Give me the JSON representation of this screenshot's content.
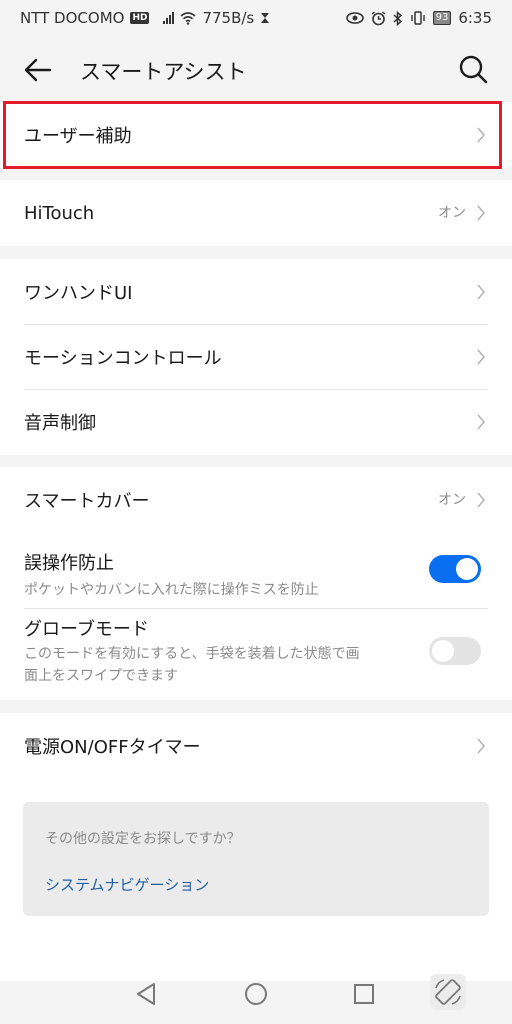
{
  "status": {
    "carrier": "NTT DOCOMO",
    "hd": "HD",
    "speed": "775B/s",
    "battery": "93",
    "time": "6:35"
  },
  "appbar": {
    "title": "スマートアシスト"
  },
  "group1": {
    "accessibility": {
      "label": "ユーザー補助"
    }
  },
  "group2": {
    "hitouch": {
      "label": "HiTouch",
      "value": "オン"
    }
  },
  "group3": {
    "onehand": {
      "label": "ワンハンドUI"
    },
    "motion": {
      "label": "モーションコントロール"
    },
    "voice": {
      "label": "音声制御"
    }
  },
  "group4": {
    "smartcover": {
      "label": "スマートカバー",
      "value": "オン"
    },
    "mistouch": {
      "label": "誤操作防止",
      "sub": "ポケットやカバンに入れた際に操作ミスを防止",
      "enabled": true
    },
    "glove": {
      "label": "グローブモード",
      "sub_line1": "このモードを有効にすると、手袋を装着した状態で画",
      "sub_line2": "面上をスワイプできます",
      "enabled": false
    }
  },
  "group5": {
    "timer": {
      "label": "電源ON/OFFタイマー"
    }
  },
  "card": {
    "question": "その他の設定をお探しですか？",
    "link": "システムナビゲーション"
  },
  "colors": {
    "accent": "#0a6ef0",
    "highlight": "#e31b2b",
    "link": "#1f5fa8"
  }
}
